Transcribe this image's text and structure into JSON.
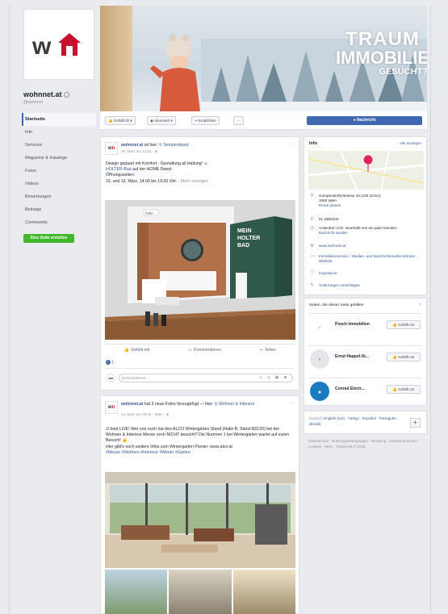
{
  "page": {
    "name": "wohnnet.at",
    "handle": "@wohnnet",
    "logo_text": "wn"
  },
  "left_nav": {
    "items": [
      "Startseite",
      "Info",
      "Services",
      "Magazine & Kataloge",
      "Fotos",
      "Videos",
      "Bewertungen",
      "Beiträge",
      "Community"
    ],
    "create_button": "Eine Seite erstellen"
  },
  "cover": {
    "line1": "TRAUM",
    "line2": "IMMOBILIE",
    "line3": "GESUCHT?"
  },
  "action_bar": {
    "like": "Gefällt dir",
    "follow": "Abonniert",
    "share": "Empfehlen",
    "more": "···",
    "message": "Nachricht"
  },
  "post1": {
    "author": "wohnnet.at",
    "verb": "ist hier:",
    "place": "Semperdepot",
    "meta": "15. März um 14:32 · ⊕",
    "line1": "Design gepaart mit Komfort - Gestaltung all Hallung! ☺",
    "line2_link": "HOLTER-Bad",
    "line2_rest": " auf der HOME Depot",
    "line3": "Öffnungszeiten:",
    "line4": "15. und 16. März, 14.00 bis 19.00 Uhr.",
    "more_link": " · Mehr anzeigen",
    "sign_line1": "MEIN",
    "sign_line2": "HOLTER",
    "sign_line3": "BAD",
    "small_sign": "holter",
    "react_like": "Gefällt mir",
    "react_comment": "Kommentieren",
    "react_share": "Teilen",
    "like_count": "1",
    "comment_placeholder": "Kommentieren ...",
    "comment_icons": "☺ ◎ ▣ ☻"
  },
  "post2": {
    "author": "wohnnet.at",
    "verb": "hat 3 neue Fotos hinzugefügt — hier:",
    "place": "Wohnen & Interieur",
    "meta": "14. März um 09:16 · Wien · ⊕",
    "line1": "☑Jetzt LIVE! Wer von euch hat den ALCO Wintergärten Stand (Halle B, Stand B0120) bei der Wohnen & Interieur Messe noch NICHT besucht? Die Nummer 1 bei Wintergärten wartet auf euren Besuch! 👍",
    "line2": "Hier gibt's noch weitere Infos zum Wintergarten Pionier: www.alco.at",
    "line3": "#Messe #Wohnen #Interieur #Winter #Garten"
  },
  "info": {
    "title": "Info",
    "see_all": "Alle anzeigen",
    "address1": "Gumpendorferstrasse 19 (100.18 km)",
    "address2": "1060 Wien",
    "route": "Route planen",
    "phone": "01 2950100",
    "reply": "Antwortet i.d.R. innerhalb von ein paar Stunden",
    "message_link": "Nachricht senden",
    "website": "www.wohnnet.at",
    "category": "Immobilienservice · Medien- und Nachrichtenunternehmen · Website",
    "imprint": "Impressum",
    "suggest": "Änderungen vorschlagen"
  },
  "liked": {
    "title": "Seiten, die dieser Seite gefallen",
    "items": [
      {
        "name": "Posch Immobilien",
        "button": "Gefällt mir"
      },
      {
        "name": "Ernst-Happel-St...",
        "button": "Gefällt mir"
      },
      {
        "name": "Conrad Electr...",
        "button": "Gefällt mir"
      }
    ]
  },
  "languages": {
    "current": "Deutsch",
    "others": "English (US) · Türkçe · Español · Português (Brasil)",
    "add": "+"
  },
  "footer": {
    "text": "Datenschutz · Nutzungsbedingungen · Werbung · Datenschutzinfo ▷ · Cookies · Mehr · Facebook © 2018"
  },
  "colors": {
    "fb_blue": "#4267b2",
    "link_blue": "#365899",
    "brand_red": "#c8102e",
    "green": "#42b72a"
  }
}
